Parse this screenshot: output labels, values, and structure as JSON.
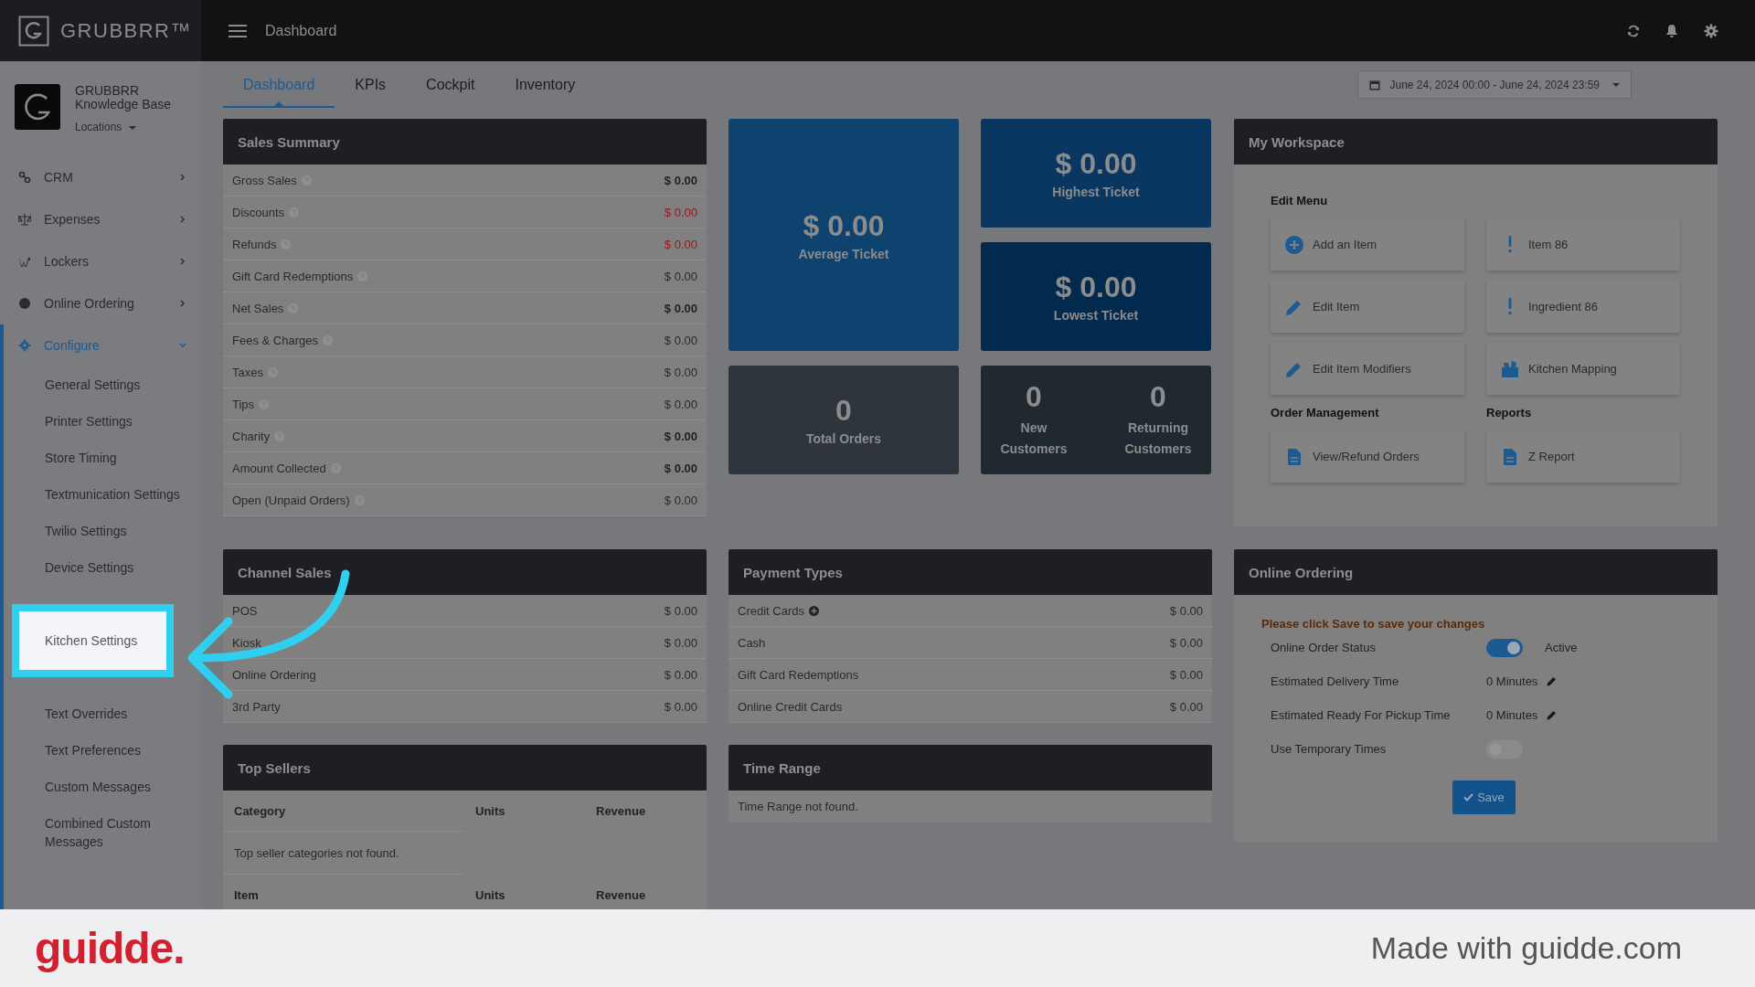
{
  "brand": {
    "name": "GRUBBRR™"
  },
  "topbar": {
    "title": "Dashboard"
  },
  "profile": {
    "name": "GRUBBRR Knowledge Base",
    "locations": "Locations"
  },
  "sidebar": {
    "items": [
      {
        "label": "CRM",
        "selected": false,
        "expanded": false
      },
      {
        "label": "Expenses",
        "selected": false,
        "expanded": false
      },
      {
        "label": "Lockers",
        "selected": false,
        "expanded": false
      },
      {
        "label": "Online Ordering",
        "selected": false,
        "expanded": false
      },
      {
        "label": "Configure",
        "selected": true,
        "expanded": true,
        "children": [
          {
            "label": "General Settings",
            "highlighted": false
          },
          {
            "label": "Printer Settings",
            "highlighted": false
          },
          {
            "label": "Store Timing",
            "highlighted": false
          },
          {
            "label": "Textmunication Settings",
            "highlighted": false
          },
          {
            "label": "Twilio Settings",
            "highlighted": false
          },
          {
            "label": "Device Settings",
            "highlighted": false
          },
          {
            "label": "Kitchen Settings",
            "highlighted": true
          },
          {
            "label": "Text Overrides",
            "highlighted": false
          },
          {
            "label": "Text Preferences",
            "highlighted": false
          },
          {
            "label": "Custom Messages",
            "highlighted": false
          },
          {
            "label": "Combined Custom Messages",
            "highlighted": false
          }
        ]
      }
    ]
  },
  "tabs": [
    {
      "label": "Dashboard",
      "selected": true
    },
    {
      "label": "KPIs",
      "selected": false
    },
    {
      "label": "Cockpit",
      "selected": false
    },
    {
      "label": "Inventory",
      "selected": false
    }
  ],
  "date_range": "June 24, 2024 00:00 - June 24, 2024 23:59",
  "sales_summary": {
    "title": "Sales Summary",
    "rows": [
      {
        "label": "Gross Sales",
        "value": "$ 0.00",
        "kind": "bold"
      },
      {
        "label": "Discounts",
        "value": "$ 0.00",
        "kind": "negative"
      },
      {
        "label": "Refunds",
        "value": "$ 0.00",
        "kind": "negative"
      },
      {
        "label": "Gift Card Redemptions",
        "value": "$ 0.00",
        "kind": "plain"
      },
      {
        "label": "Net Sales",
        "value": "$ 0.00",
        "kind": "bold"
      },
      {
        "label": "Fees & Charges",
        "value": "$ 0.00",
        "kind": "plain"
      },
      {
        "label": "Taxes",
        "value": "$ 0.00",
        "kind": "plain"
      },
      {
        "label": "Tips",
        "value": "$ 0.00",
        "kind": "plain"
      },
      {
        "label": "Charity",
        "value": "$ 0.00",
        "kind": "bold"
      },
      {
        "label": "Amount Collected",
        "value": "$ 0.00",
        "kind": "bold"
      },
      {
        "label": "Open (Unpaid Orders)",
        "value": "$ 0.00",
        "kind": "plain"
      }
    ]
  },
  "tiles": [
    {
      "kind": "single",
      "color": "#0e426f",
      "stats": [
        {
          "value": "$ 0.00",
          "label": "Average Ticket"
        }
      ]
    },
    {
      "kind": "single",
      "color": "#093762",
      "stats": [
        {
          "value": "$ 0.00",
          "label": "Highest Ticket"
        }
      ]
    },
    {
      "kind": "single",
      "color": "#022a4f",
      "stats": [
        {
          "value": "$ 0.00",
          "label": "Lowest Ticket"
        }
      ]
    },
    {
      "kind": "single",
      "color": "#2f353d",
      "stats": [
        {
          "value": "0",
          "label": "Total Orders"
        }
      ]
    },
    {
      "kind": "pair",
      "color": "#212930",
      "stats": [
        {
          "value": "0",
          "label": "New Customers"
        },
        {
          "value": "0",
          "label": "Returning Customers"
        }
      ]
    }
  ],
  "workspace": {
    "title": "My Workspace",
    "sections": [
      {
        "title": "Edit Menu",
        "items": [
          {
            "label": "Add an Item"
          },
          {
            "label": "Item 86"
          },
          {
            "label": "Edit Item"
          },
          {
            "label": "Ingredient 86"
          },
          {
            "label": "Edit Item Modifiers"
          },
          {
            "label": "Kitchen Mapping"
          }
        ]
      },
      {
        "title": "Order Management",
        "items": [
          {
            "label": "View/Refund Orders"
          }
        ]
      },
      {
        "title": "Reports",
        "items": [
          {
            "label": "Z Report"
          }
        ]
      }
    ]
  },
  "channel_sales": {
    "title": "Channel Sales",
    "rows": [
      {
        "label": "POS",
        "value": "$ 0.00"
      },
      {
        "label": "Kiosk",
        "value": "$ 0.00"
      },
      {
        "label": "Online Ordering",
        "value": "$ 0.00"
      },
      {
        "label": "3rd Party",
        "value": "$ 0.00"
      }
    ]
  },
  "payment_types": {
    "title": "Payment Types",
    "rows": [
      {
        "label": "Credit Cards",
        "value": "$ 0.00",
        "expandable": true
      },
      {
        "label": "Cash",
        "value": "$ 0.00",
        "expandable": false
      },
      {
        "label": "Gift Card Redemptions",
        "value": "$ 0.00",
        "expandable": false
      },
      {
        "label": "Online Credit Cards",
        "value": "$ 0.00",
        "expandable": false
      }
    ]
  },
  "online_ordering": {
    "title": "Online Ordering",
    "notice": "Please click Save to save your changes",
    "rows": [
      {
        "kind": "toggle",
        "label": "Online Order Status",
        "on": true,
        "value": "Active"
      },
      {
        "kind": "edit",
        "label": "Estimated Delivery Time",
        "value": "0 Minutes"
      },
      {
        "kind": "edit",
        "label": "Estimated Ready For Pickup Time",
        "value": "0 Minutes"
      },
      {
        "kind": "toggle",
        "label": "Use Temporary Times",
        "on": false
      }
    ],
    "save": "Save"
  },
  "top_sellers": {
    "title": "Top Sellers",
    "columns": [
      "Category",
      "Units",
      "Revenue"
    ],
    "empty": "Top seller categories not found.",
    "columns_2": [
      "Item",
      "Units",
      "Revenue"
    ]
  },
  "time_range": {
    "title": "Time Range",
    "empty": "Time Range not found."
  },
  "footer": {
    "logo": "guidde.",
    "credit": "Made with guidde.com"
  }
}
